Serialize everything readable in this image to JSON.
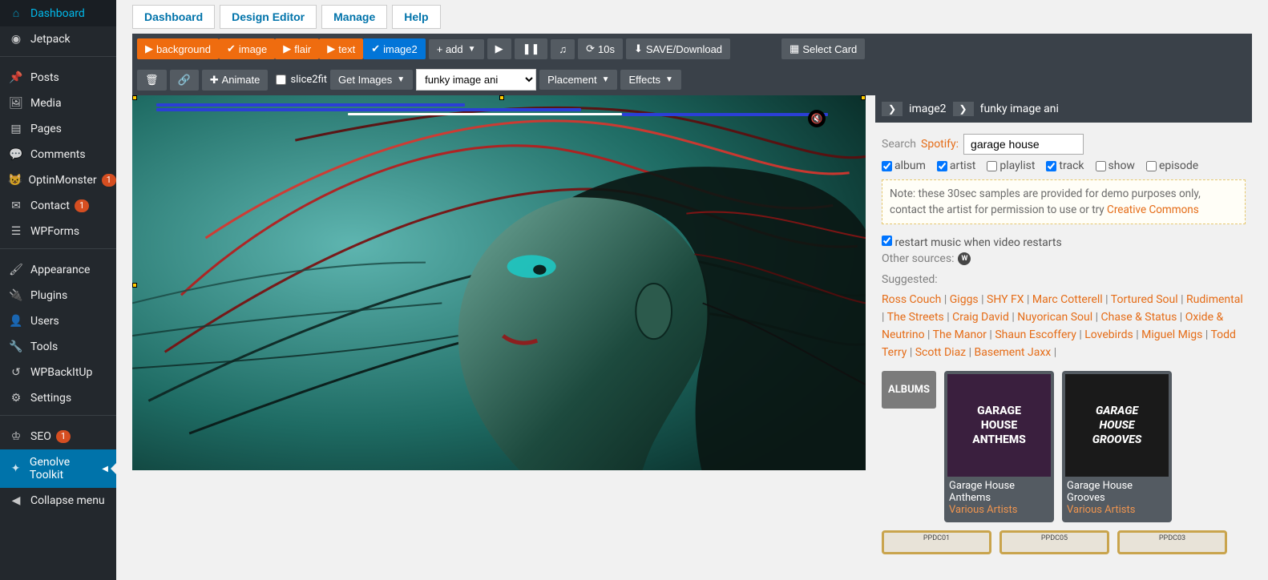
{
  "wp_sidebar": [
    {
      "icon": "⌂",
      "label": "Dashboard",
      "badge": null,
      "active": false
    },
    {
      "icon": "◉",
      "label": "Jetpack",
      "badge": null,
      "active": false
    },
    {
      "sep": true
    },
    {
      "icon": "📌",
      "label": "Posts",
      "badge": null,
      "active": false
    },
    {
      "icon": "🖼",
      "label": "Media",
      "badge": null,
      "active": false
    },
    {
      "icon": "▤",
      "label": "Pages",
      "badge": null,
      "active": false
    },
    {
      "icon": "💬",
      "label": "Comments",
      "badge": null,
      "active": false
    },
    {
      "icon": "😺",
      "label": "OptinMonster",
      "badge": "1",
      "active": false
    },
    {
      "icon": "✉",
      "label": "Contact",
      "badge": "1",
      "active": false
    },
    {
      "icon": "☰",
      "label": "WPForms",
      "badge": null,
      "active": false
    },
    {
      "sep": true
    },
    {
      "icon": "🖌",
      "label": "Appearance",
      "badge": null,
      "active": false
    },
    {
      "icon": "🔌",
      "label": "Plugins",
      "badge": null,
      "active": false
    },
    {
      "icon": "👤",
      "label": "Users",
      "badge": null,
      "active": false
    },
    {
      "icon": "🔧",
      "label": "Tools",
      "badge": null,
      "active": false
    },
    {
      "icon": "↺",
      "label": "WPBackItUp",
      "badge": null,
      "active": false
    },
    {
      "icon": "⚙",
      "label": "Settings",
      "badge": null,
      "active": false
    },
    {
      "sep": true
    },
    {
      "icon": "♔",
      "label": "SEO",
      "badge": "1",
      "active": false
    },
    {
      "icon": "✦",
      "label": "Genolve Toolkit",
      "badge": null,
      "active": true,
      "chev": true
    },
    {
      "icon": "◀",
      "label": "Collapse menu",
      "badge": null,
      "active": false
    }
  ],
  "top_tabs": [
    "Dashboard",
    "Design Editor",
    "Manage",
    "Help"
  ],
  "toolbar1": {
    "items": [
      {
        "type": "orange",
        "prefix": "▶",
        "label": "background"
      },
      {
        "type": "orange",
        "prefix": "✔",
        "label": "image"
      },
      {
        "type": "orange",
        "prefix": "▶",
        "label": "flair"
      },
      {
        "type": "orange",
        "prefix": "▶",
        "label": "text"
      },
      {
        "type": "blue",
        "prefix": "✔",
        "label": "image2"
      }
    ],
    "add": "+ add",
    "play": "▶",
    "pause": "❚❚",
    "music": "♫",
    "timer_label": "10s",
    "save_label": "SAVE/Download",
    "select_card": "Select Card"
  },
  "toolbar2": {
    "animate": "Animate",
    "slice2fit": "slice2fit",
    "get_images": "Get Images",
    "combo_value": "funky image ani",
    "placement": "Placement",
    "effects": "Effects"
  },
  "panel_head": {
    "layer": "image2",
    "anim": "funky image ani"
  },
  "search": {
    "label": "Search",
    "brand": "Spotify:",
    "value": "garage house"
  },
  "filters": [
    {
      "label": "album",
      "checked": true
    },
    {
      "label": "artist",
      "checked": true
    },
    {
      "label": "playlist",
      "checked": false
    },
    {
      "label": "track",
      "checked": true
    },
    {
      "label": "show",
      "checked": false
    },
    {
      "label": "episode",
      "checked": false
    }
  ],
  "note": {
    "pre": "Note: these 30sec samples are provided for demo purposes only, contact the artist for permission to use or try ",
    "link": "Creative Commons"
  },
  "restart": {
    "label": "restart music when video restarts",
    "checked": true
  },
  "other_label": "Other sources:",
  "suggested_label": "Suggested:",
  "suggested": [
    "Ross Couch",
    "Giggs",
    "SHY FX",
    "Marc Cotterell",
    "Tortured Soul",
    "Rudimental",
    "The Streets",
    "Craig David",
    "Nuyorican Soul",
    "Chase & Status",
    "Oxide & Neutrino",
    "The Manor",
    "Shaun Escoffery",
    "Lovebirds",
    "Miguel Migs",
    "Todd Terry",
    "Scott Diaz",
    "Basement Jaxx"
  ],
  "albums_label": "ALBUMS",
  "albums": [
    {
      "title": "Garage House Anthems",
      "artist": "Various Artists",
      "cov": "GARAGE HOUSE ANTHEMS",
      "class": ""
    },
    {
      "title": "Garage House Grooves",
      "artist": "Various Artists",
      "cov": "GARAGE HOUSE GROOVES",
      "class": "grooves"
    }
  ],
  "placeholders": [
    "PPDC01",
    "PPDC05",
    "PPDC03"
  ]
}
